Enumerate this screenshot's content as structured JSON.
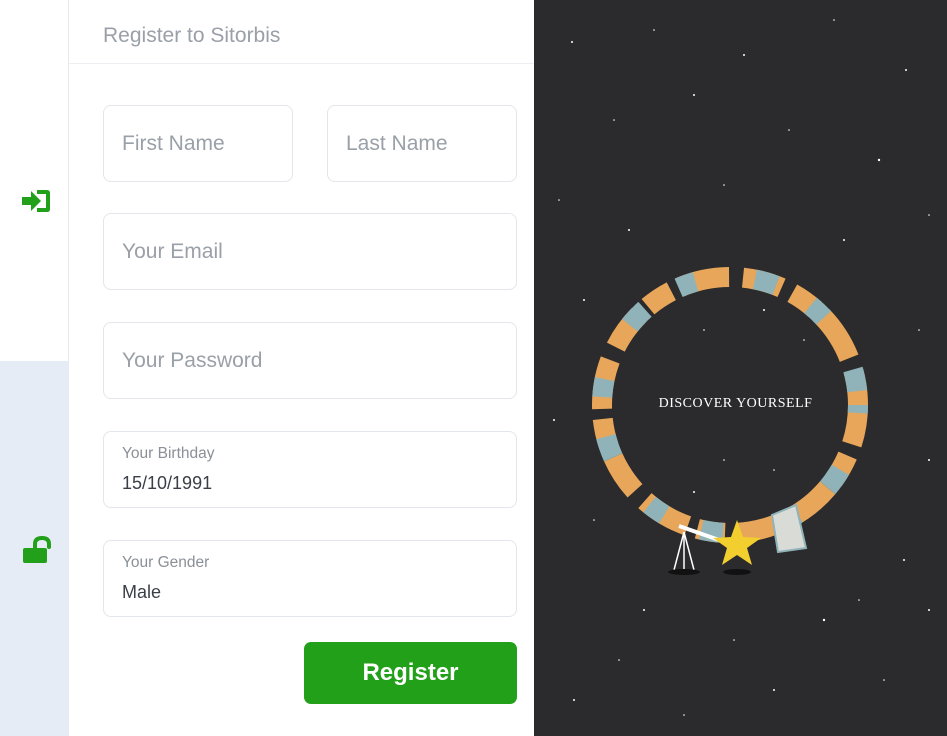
{
  "sidebar": {
    "icons": [
      "sign-in-icon",
      "unlock-icon"
    ],
    "accent_color": "#22a01a"
  },
  "form": {
    "title": "Register to Sitorbis",
    "first_name_placeholder": "First Name",
    "last_name_placeholder": "Last Name",
    "email_placeholder": "Your Email",
    "password_placeholder": "Your Password",
    "birthday": {
      "label": "Your Birthday",
      "value": "15/10/1991"
    },
    "gender": {
      "label": "Your Gender",
      "value": "Male"
    },
    "submit_label": "Register"
  },
  "illustration": {
    "caption": "DISCOVER YOURSELF"
  }
}
